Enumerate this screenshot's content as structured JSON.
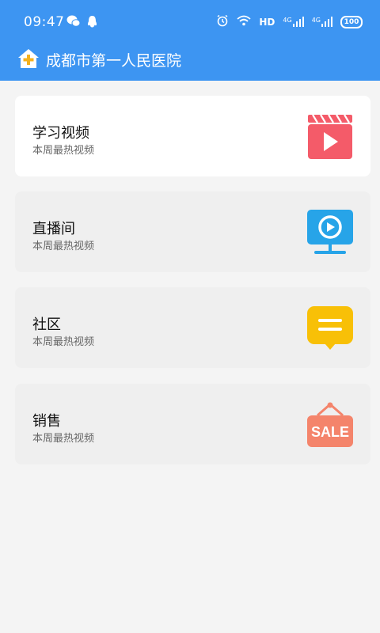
{
  "status_bar": {
    "time": "09:47",
    "network_label": "HD",
    "signal1_label": "4G",
    "signal2_label": "4G",
    "battery": "100"
  },
  "header": {
    "title": "成都市第一人民医院"
  },
  "menu": [
    {
      "title": "学习视频",
      "subtitle": "本周最热视频",
      "icon": "video-play-icon"
    },
    {
      "title": "直播间",
      "subtitle": "本周最热视频",
      "icon": "live-monitor-icon"
    },
    {
      "title": "社区",
      "subtitle": "本周最热视频",
      "icon": "chat-bubble-icon"
    },
    {
      "title": "销售",
      "subtitle": "本周最热视频",
      "icon": "sale-sign-icon"
    }
  ],
  "colors": {
    "header_blue": "#3d95f2",
    "video_red": "#f45b69",
    "live_blue": "#27a4e8",
    "chat_yellow": "#f8c007",
    "sale_orange": "#f4846b"
  }
}
